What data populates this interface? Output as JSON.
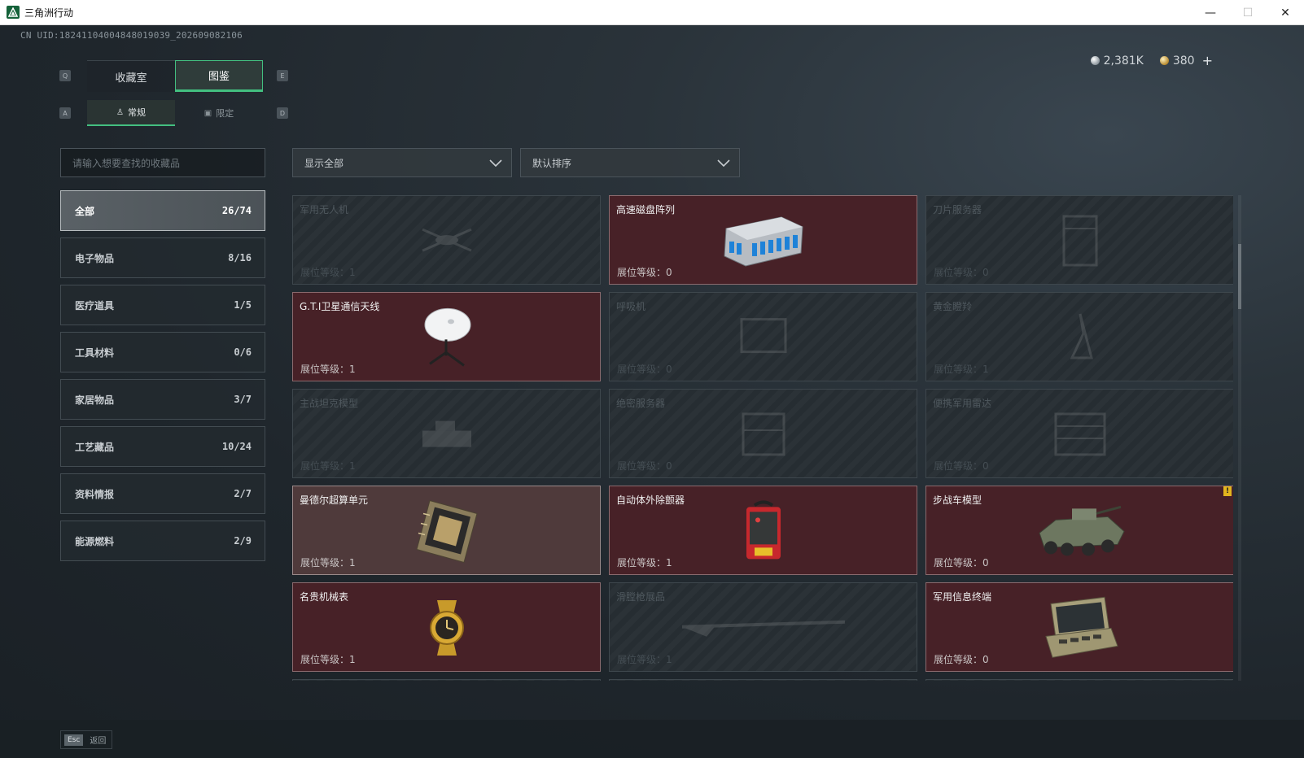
{
  "window": {
    "title": "三角洲行动",
    "minimize_glyph": "—",
    "maximize_glyph": "☐",
    "close_glyph": "✕",
    "icon": "delta-logo-icon",
    "accent": "#15623a"
  },
  "uid": "CN UID:18241104004848019039_202609082106",
  "currency": {
    "silver": "2,381K",
    "gold": "380",
    "add": "+"
  },
  "keys": {
    "q": "Q",
    "e": "E",
    "a": "A",
    "d": "D"
  },
  "main_tabs": [
    {
      "label": "收藏室",
      "active": false
    },
    {
      "label": "图鉴",
      "active": true
    }
  ],
  "sub_tabs": [
    {
      "label": "常规",
      "icon": "figure-icon",
      "active": true
    },
    {
      "label": "限定",
      "icon": "image-icon",
      "active": false
    }
  ],
  "search": {
    "placeholder": "请输入想要查找的收藏品"
  },
  "filter": {
    "label": "显示全部"
  },
  "sort": {
    "label": "默认排序"
  },
  "categories": [
    {
      "label": "全部",
      "count": "26/74",
      "active": true
    },
    {
      "label": "电子物品",
      "count": "8/16"
    },
    {
      "label": "医疗道具",
      "count": "1/5"
    },
    {
      "label": "工具材料",
      "count": "0/6"
    },
    {
      "label": "家居物品",
      "count": "3/7"
    },
    {
      "label": "工艺藏品",
      "count": "10/24"
    },
    {
      "label": "资料情报",
      "count": "2/7"
    },
    {
      "label": "能源燃料",
      "count": "2/9"
    }
  ],
  "level_prefix": "展位等级：",
  "items": [
    {
      "name": "军用无人机",
      "level": "1",
      "state": "locked",
      "icon": "drone-icon"
    },
    {
      "name": "高速磁盘阵列",
      "level": "0",
      "state": "owned",
      "icon": "disk-array-icon"
    },
    {
      "name": "刀片服务器",
      "level": "0",
      "state": "locked",
      "icon": "blade-server-icon"
    },
    {
      "name": "G.T.I卫星通信天线",
      "level": "1",
      "state": "owned",
      "icon": "satellite-dish-icon"
    },
    {
      "name": "呼吸机",
      "level": "0",
      "state": "locked",
      "icon": "ventilator-icon"
    },
    {
      "name": "黄金瞪羚",
      "level": "1",
      "state": "locked",
      "icon": "gazelle-icon"
    },
    {
      "name": "主战坦克模型",
      "level": "1",
      "state": "locked",
      "icon": "tank-model-icon"
    },
    {
      "name": "绝密服务器",
      "level": "0",
      "state": "locked",
      "icon": "server-icon"
    },
    {
      "name": "便携军用雷达",
      "level": "0",
      "state": "locked",
      "icon": "radar-icon"
    },
    {
      "name": "曼德尔超算单元",
      "level": "1",
      "state": "highlight",
      "icon": "cpu-unit-icon"
    },
    {
      "name": "自动体外除颤器",
      "level": "1",
      "state": "owned",
      "icon": "defibrillator-icon"
    },
    {
      "name": "步战车模型",
      "level": "0",
      "state": "owned",
      "icon": "ifv-model-icon",
      "badge": "!"
    },
    {
      "name": "名贵机械表",
      "level": "1",
      "state": "owned",
      "icon": "watch-icon"
    },
    {
      "name": "滑膛枪展品",
      "level": "1",
      "state": "locked",
      "icon": "musket-icon"
    },
    {
      "name": "军用信息终端",
      "level": "0",
      "state": "owned",
      "icon": "terminal-icon"
    }
  ],
  "footer": {
    "esc_key": "Esc",
    "back_label": "返回"
  },
  "colors": {
    "accent_green": "#43bf80",
    "owned_card": "#472127",
    "highlight_card": "#4f3a3b",
    "badge": "#e3b51e"
  }
}
